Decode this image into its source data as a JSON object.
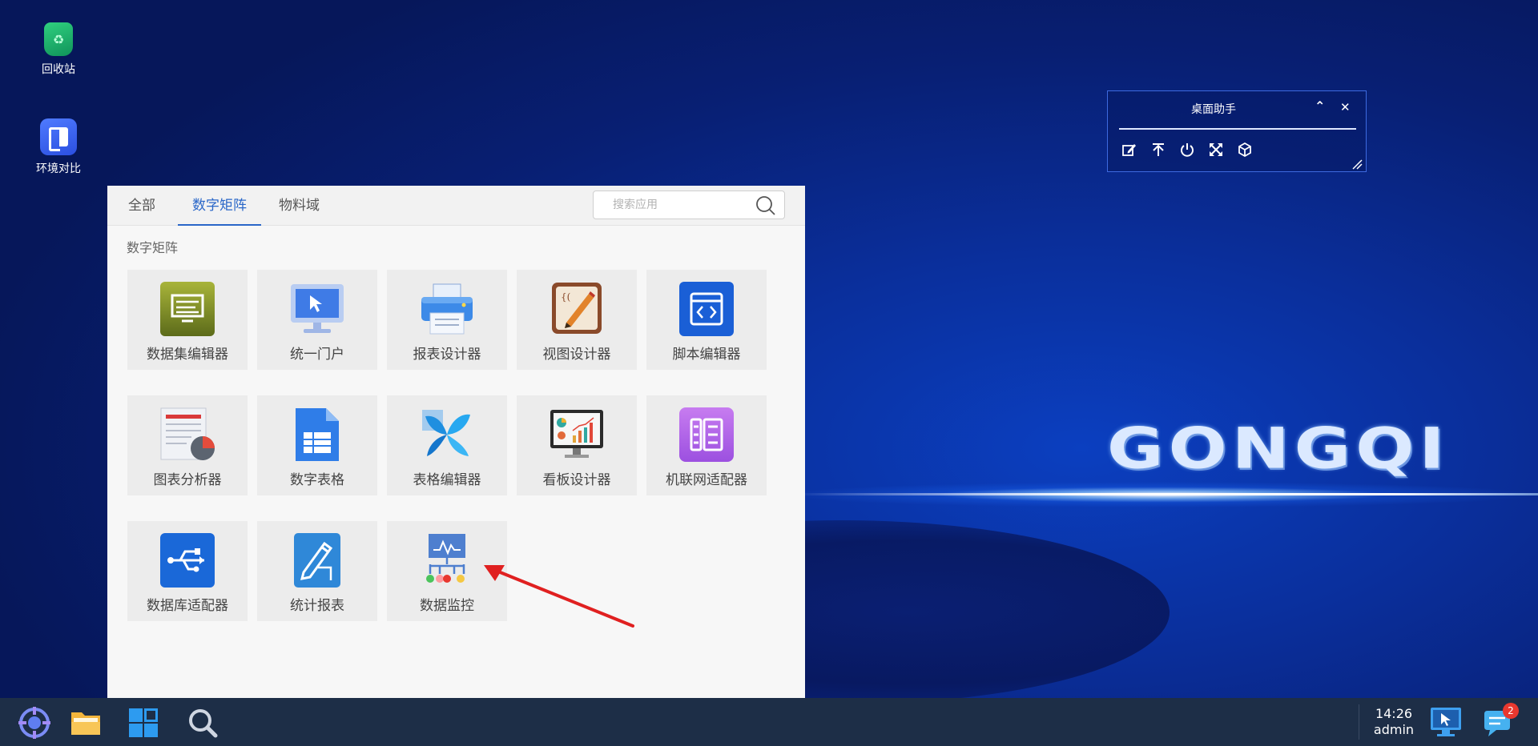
{
  "desktop": {
    "icons": [
      {
        "label": "回收站",
        "icon": "recycle-bin-icon"
      },
      {
        "label": "环境对比",
        "icon": "compare-icon"
      }
    ],
    "brand": "GONGQI"
  },
  "assistant": {
    "title": "桌面助手",
    "collapse_glyph": "⌃",
    "close_glyph": "✕",
    "tools": [
      "edit-icon",
      "pin-top-icon",
      "power-icon",
      "expand-icon",
      "cube-icon"
    ]
  },
  "launcher": {
    "tabs": [
      {
        "label": "全部",
        "active": false
      },
      {
        "label": "数字矩阵",
        "active": true
      },
      {
        "label": "物料域",
        "active": false
      }
    ],
    "search": {
      "placeholder": "搜索应用"
    },
    "section_title": "数字矩阵",
    "apps": [
      {
        "label": "数据集编辑器",
        "icon": "dataset-editor-icon"
      },
      {
        "label": "统一门户",
        "icon": "portal-icon"
      },
      {
        "label": "报表设计器",
        "icon": "printer-icon"
      },
      {
        "label": "视图设计器",
        "icon": "view-designer-icon"
      },
      {
        "label": "脚本编辑器",
        "icon": "script-editor-icon"
      },
      {
        "label": "图表分析器",
        "icon": "chart-analyzer-icon"
      },
      {
        "label": "数字表格",
        "icon": "spreadsheet-icon"
      },
      {
        "label": "表格编辑器",
        "icon": "table-editor-icon"
      },
      {
        "label": "看板设计器",
        "icon": "dashboard-icon"
      },
      {
        "label": "机联网适配器",
        "icon": "iot-adapter-icon"
      },
      {
        "label": "数据库适配器",
        "icon": "usb-adapter-icon"
      },
      {
        "label": "统计报表",
        "icon": "stats-report-icon"
      },
      {
        "label": "数据监控",
        "icon": "data-monitor-icon"
      }
    ]
  },
  "taskbar": {
    "buttons": [
      "start-menu-icon",
      "file-manager-icon",
      "windows-icon",
      "search-icon"
    ],
    "time": "14:26",
    "user": "admin",
    "notification_count": "2"
  },
  "colors": {
    "accent": "#2a67c8",
    "taskbar": "#1d2e47",
    "badge": "#e8382f",
    "annotation_arrow": "#e02020"
  }
}
